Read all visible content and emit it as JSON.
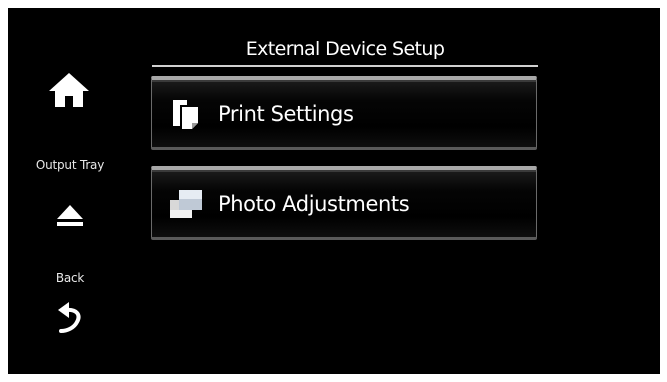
{
  "header": {
    "title": "External Device Setup"
  },
  "sidebar": {
    "home_icon": "home-icon",
    "output_tray_label": "Output Tray",
    "output_tray_icon": "eject-icon",
    "back_label": "Back",
    "back_icon": "back-arrow-icon"
  },
  "menu": {
    "items": [
      {
        "label": "Print Settings",
        "icon": "print-settings-icon"
      },
      {
        "label": "Photo Adjustments",
        "icon": "photo-adjustments-icon"
      }
    ]
  },
  "colors": {
    "background": "#000000",
    "text": "#ffffff",
    "button_border": "#a8a8a8"
  }
}
